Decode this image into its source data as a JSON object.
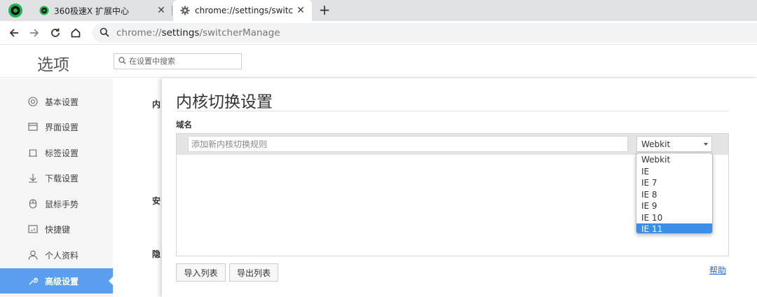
{
  "colors": {
    "accent": "#5b9ef0",
    "selected_option": "#3b8fe8",
    "link": "#2a6ad6",
    "logo_green": "#1fb54d"
  },
  "tabs": [
    {
      "title": "360极速X 扩展中心",
      "icon": "green-circle-icon",
      "active": false
    },
    {
      "title": "chrome://settings/switcher",
      "icon": "gear-icon",
      "active": true
    }
  ],
  "toolbar": {
    "url_scheme": "chrome://",
    "url_host": "settings",
    "url_path": "/switcherManage"
  },
  "settings": {
    "title": "选项",
    "search_placeholder": "在设置中搜索"
  },
  "sidebar": {
    "items": [
      {
        "label": "基本设置",
        "icon": "target-icon"
      },
      {
        "label": "界面设置",
        "icon": "window-icon"
      },
      {
        "label": "标签设置",
        "icon": "tab-icon"
      },
      {
        "label": "下载设置",
        "icon": "download-icon"
      },
      {
        "label": "鼠标手势",
        "icon": "mouse-icon"
      },
      {
        "label": "快捷键",
        "icon": "keyboard-icon"
      },
      {
        "label": "个人资料",
        "icon": "person-icon"
      },
      {
        "label": "高级设置",
        "icon": "wrench-icon",
        "active": true
      }
    ]
  },
  "background_sections": [
    "内",
    "安",
    "隐"
  ],
  "dialog": {
    "title": "内核切换设置",
    "domain_label": "域名",
    "rule_placeholder": "添加新内核切换规则",
    "selected_core": "Webkit",
    "core_options": [
      "Webkit",
      "IE",
      "IE 7",
      "IE 8",
      "IE 9",
      "IE 10",
      "IE 11"
    ],
    "highlighted_option": "IE 11",
    "import_button": "导入列表",
    "export_button": "导出列表",
    "help_link": "帮助"
  }
}
